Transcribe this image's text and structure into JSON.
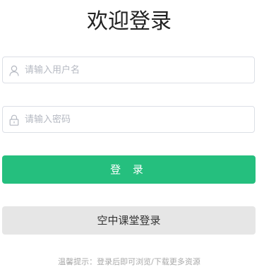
{
  "page": {
    "title": "欢迎登录"
  },
  "username": {
    "placeholder": "请输入用户名",
    "icon": "user-icon"
  },
  "password": {
    "placeholder": "请输入密码",
    "icon": "lock-icon"
  },
  "buttons": {
    "login_label": "登 录",
    "classroom_login_label": "空中课堂登录"
  },
  "tip": {
    "text": "温馨提示：登录后即可浏览/下载更多资源"
  },
  "colors": {
    "primary": "#25bf7e",
    "secondary_button": "#e6e6e6",
    "border": "#dcdfe6",
    "placeholder": "#b5b9c2"
  }
}
